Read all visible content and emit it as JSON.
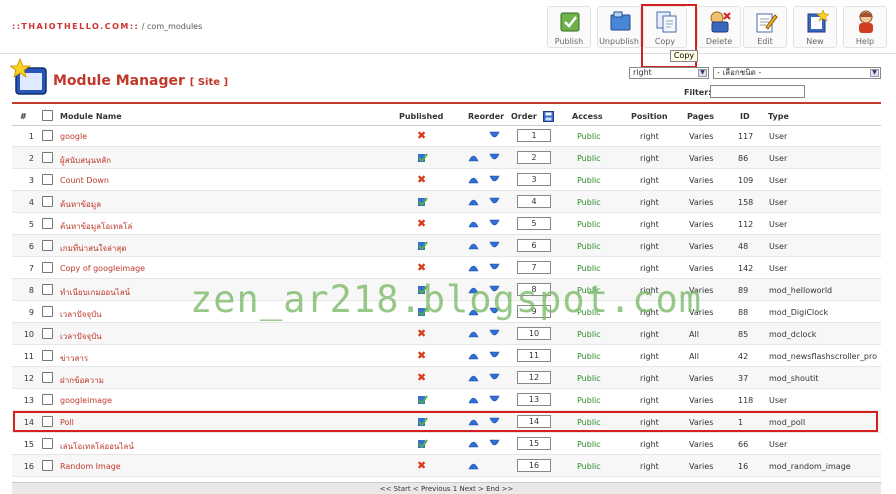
{
  "breadcrumb": {
    "site": "::THAIOTHELLO.COM::",
    "path": "/ com_modules"
  },
  "toolbar": [
    {
      "label": "Publish",
      "icon": "publish-icon"
    },
    {
      "label": "Unpublish",
      "icon": "unpublish-icon"
    },
    {
      "label": "Copy",
      "icon": "copy-icon"
    },
    {
      "label": "Delete",
      "icon": "delete-icon"
    },
    {
      "label": "Edit",
      "icon": "edit-icon"
    },
    {
      "label": "New",
      "icon": "new-icon"
    },
    {
      "label": "Help",
      "icon": "help-icon"
    }
  ],
  "tooltip": "Copy",
  "header": {
    "title": "Module Manager",
    "subtitle": "[ Site ]"
  },
  "filters": {
    "position_value": "right",
    "type_value": "- เลือกชนิด -",
    "filter_label": "Filter:",
    "filter_value": ""
  },
  "columns": {
    "num": "#",
    "name": "Module Name",
    "published": "Published",
    "reorder": "Reorder",
    "order": "Order",
    "access": "Access",
    "position": "Position",
    "pages": "Pages",
    "id": "ID",
    "type": "Type"
  },
  "rows": [
    {
      "num": "1",
      "name": "google",
      "published": false,
      "up": false,
      "down": true,
      "order": "1",
      "access": "Public",
      "position": "right",
      "pages": "Varies",
      "id": "117",
      "type": "User"
    },
    {
      "num": "2",
      "name": "ผู้สนับสนุนหลัก",
      "published": true,
      "up": true,
      "down": true,
      "order": "2",
      "access": "Public",
      "position": "right",
      "pages": "Varies",
      "id": "86",
      "type": "User"
    },
    {
      "num": "3",
      "name": "Count Down",
      "published": false,
      "up": true,
      "down": true,
      "order": "3",
      "access": "Public",
      "position": "right",
      "pages": "Varies",
      "id": "109",
      "type": "User"
    },
    {
      "num": "4",
      "name": "ค้นหาข้อมูล",
      "published": true,
      "up": true,
      "down": true,
      "order": "4",
      "access": "Public",
      "position": "right",
      "pages": "Varies",
      "id": "158",
      "type": "User"
    },
    {
      "num": "5",
      "name": "ค้นหาข้อมูลโอเทลโล่",
      "published": false,
      "up": true,
      "down": true,
      "order": "5",
      "access": "Public",
      "position": "right",
      "pages": "Varies",
      "id": "112",
      "type": "User"
    },
    {
      "num": "6",
      "name": "เกมที่น่าสนใจล่าสุด",
      "published": true,
      "up": true,
      "down": true,
      "order": "6",
      "access": "Public",
      "position": "right",
      "pages": "Varies",
      "id": "48",
      "type": "User"
    },
    {
      "num": "7",
      "name": "Copy of googleimage",
      "published": false,
      "up": true,
      "down": true,
      "order": "7",
      "access": "Public",
      "position": "right",
      "pages": "Varies",
      "id": "142",
      "type": "User"
    },
    {
      "num": "8",
      "name": "ทำเนียบเกมออนไลน์",
      "published": true,
      "up": true,
      "down": true,
      "order": "8",
      "access": "Public",
      "position": "right",
      "pages": "Varies",
      "id": "89",
      "type": "mod_helloworld"
    },
    {
      "num": "9",
      "name": "เวลาปัจจุบัน",
      "published": true,
      "up": true,
      "down": true,
      "order": "9",
      "access": "Public",
      "position": "right",
      "pages": "Varies",
      "id": "88",
      "type": "mod_DigiClock"
    },
    {
      "num": "10",
      "name": "เวลาปัจจุบัน",
      "published": false,
      "up": true,
      "down": true,
      "order": "10",
      "access": "Public",
      "position": "right",
      "pages": "All",
      "id": "85",
      "type": "mod_dclock"
    },
    {
      "num": "11",
      "name": "ข่าวสาร",
      "published": false,
      "up": true,
      "down": true,
      "order": "11",
      "access": "Public",
      "position": "right",
      "pages": "All",
      "id": "42",
      "type": "mod_newsflashscroller_pro"
    },
    {
      "num": "12",
      "name": "ฝากข้อความ",
      "published": false,
      "up": true,
      "down": true,
      "order": "12",
      "access": "Public",
      "position": "right",
      "pages": "Varies",
      "id": "37",
      "type": "mod_shoutit"
    },
    {
      "num": "13",
      "name": "googleimage",
      "published": true,
      "up": true,
      "down": true,
      "order": "13",
      "access": "Public",
      "position": "right",
      "pages": "Varies",
      "id": "118",
      "type": "User"
    },
    {
      "num": "14",
      "name": "Poll",
      "published": true,
      "up": true,
      "down": true,
      "order": "14",
      "access": "Public",
      "position": "right",
      "pages": "Varies",
      "id": "1",
      "type": "mod_poll"
    },
    {
      "num": "15",
      "name": "เล่นโอเทลโล่ออนไลน์",
      "published": true,
      "up": true,
      "down": true,
      "order": "15",
      "access": "Public",
      "position": "right",
      "pages": "Varies",
      "id": "66",
      "type": "User"
    },
    {
      "num": "16",
      "name": "Random Image",
      "published": false,
      "up": true,
      "down": false,
      "order": "16",
      "access": "Public",
      "position": "right",
      "pages": "Varies",
      "id": "16",
      "type": "mod_random_image"
    }
  ],
  "watermark": "zen_ar218.blogspot.com",
  "pagination": "<< Start < Previous 1 Next > End >>",
  "colors": {
    "accent": "#c0392b",
    "access": "#2a8a2a",
    "highlight": "#d52020"
  }
}
